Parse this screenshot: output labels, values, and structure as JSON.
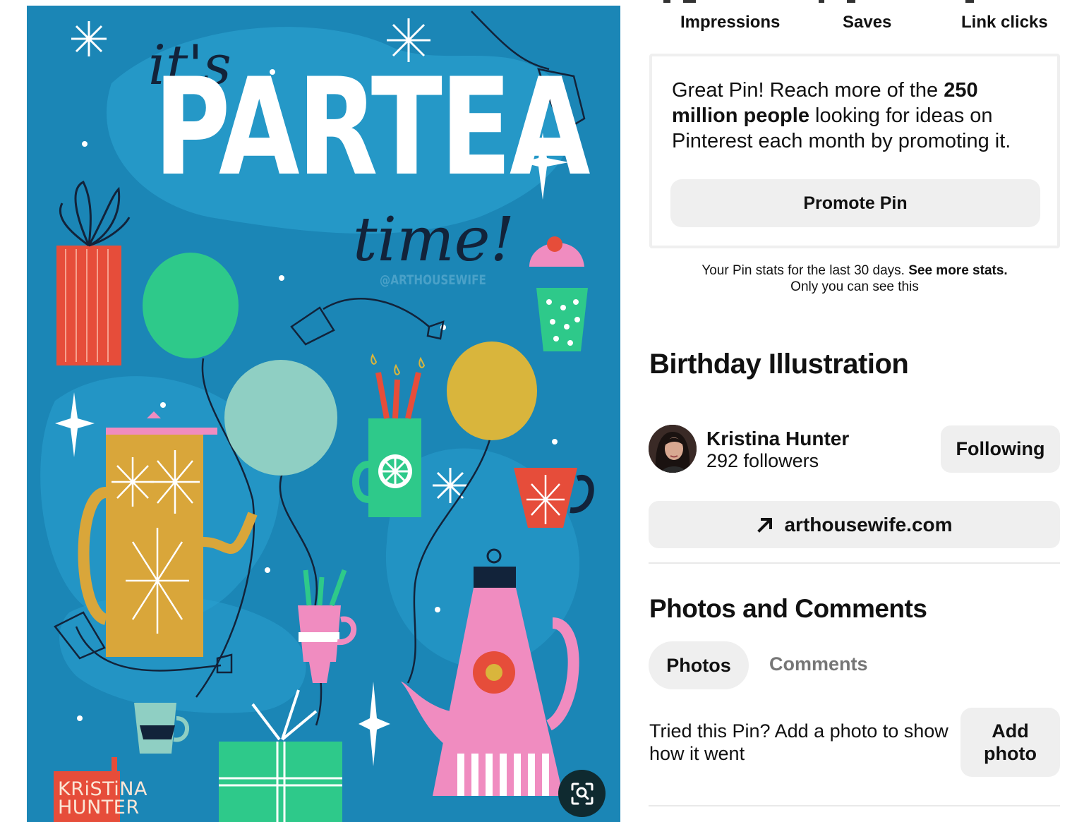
{
  "pin_image": {
    "art_text_its": "it's",
    "art_text_title": "PARTEA",
    "art_text_time": "time!",
    "art_text_credit": "@ARTHOUSEWIFE",
    "art_text_signature_line1": "KRiSTiNA",
    "art_text_signature_line2": "HUNTER",
    "visual_search_icon": "visual-search-icon"
  },
  "stats": {
    "labels": [
      "Impressions",
      "Saves",
      "Link clicks"
    ]
  },
  "promote": {
    "text_pre": "Great Pin! Reach more of the ",
    "text_bold": "250 million people",
    "text_post": " looking for ideas on Pinterest each month by promoting it.",
    "button_label": "Promote Pin"
  },
  "stats_note": {
    "line1": "Your Pin stats for the last 30 days. ",
    "link": "See more stats.",
    "line2": "Only you can see this"
  },
  "pin": {
    "title": "Birthday Illustration"
  },
  "creator": {
    "name": "Kristina Hunter",
    "followers": "292 followers",
    "follow_button": "Following"
  },
  "website": {
    "label": "arthousewife.com",
    "icon": "arrow-up-right-icon"
  },
  "photos_comments": {
    "title": "Photos and Comments",
    "tabs": [
      "Photos",
      "Comments"
    ],
    "active_tab": "Photos",
    "tried_text": "Tried this Pin? Add a photo to show how it went",
    "add_photo_button": "Add photo"
  },
  "colors": {
    "button_bg": "#efefef",
    "text": "#111111",
    "muted": "#767676",
    "pin_bg": "#1b86b6"
  }
}
